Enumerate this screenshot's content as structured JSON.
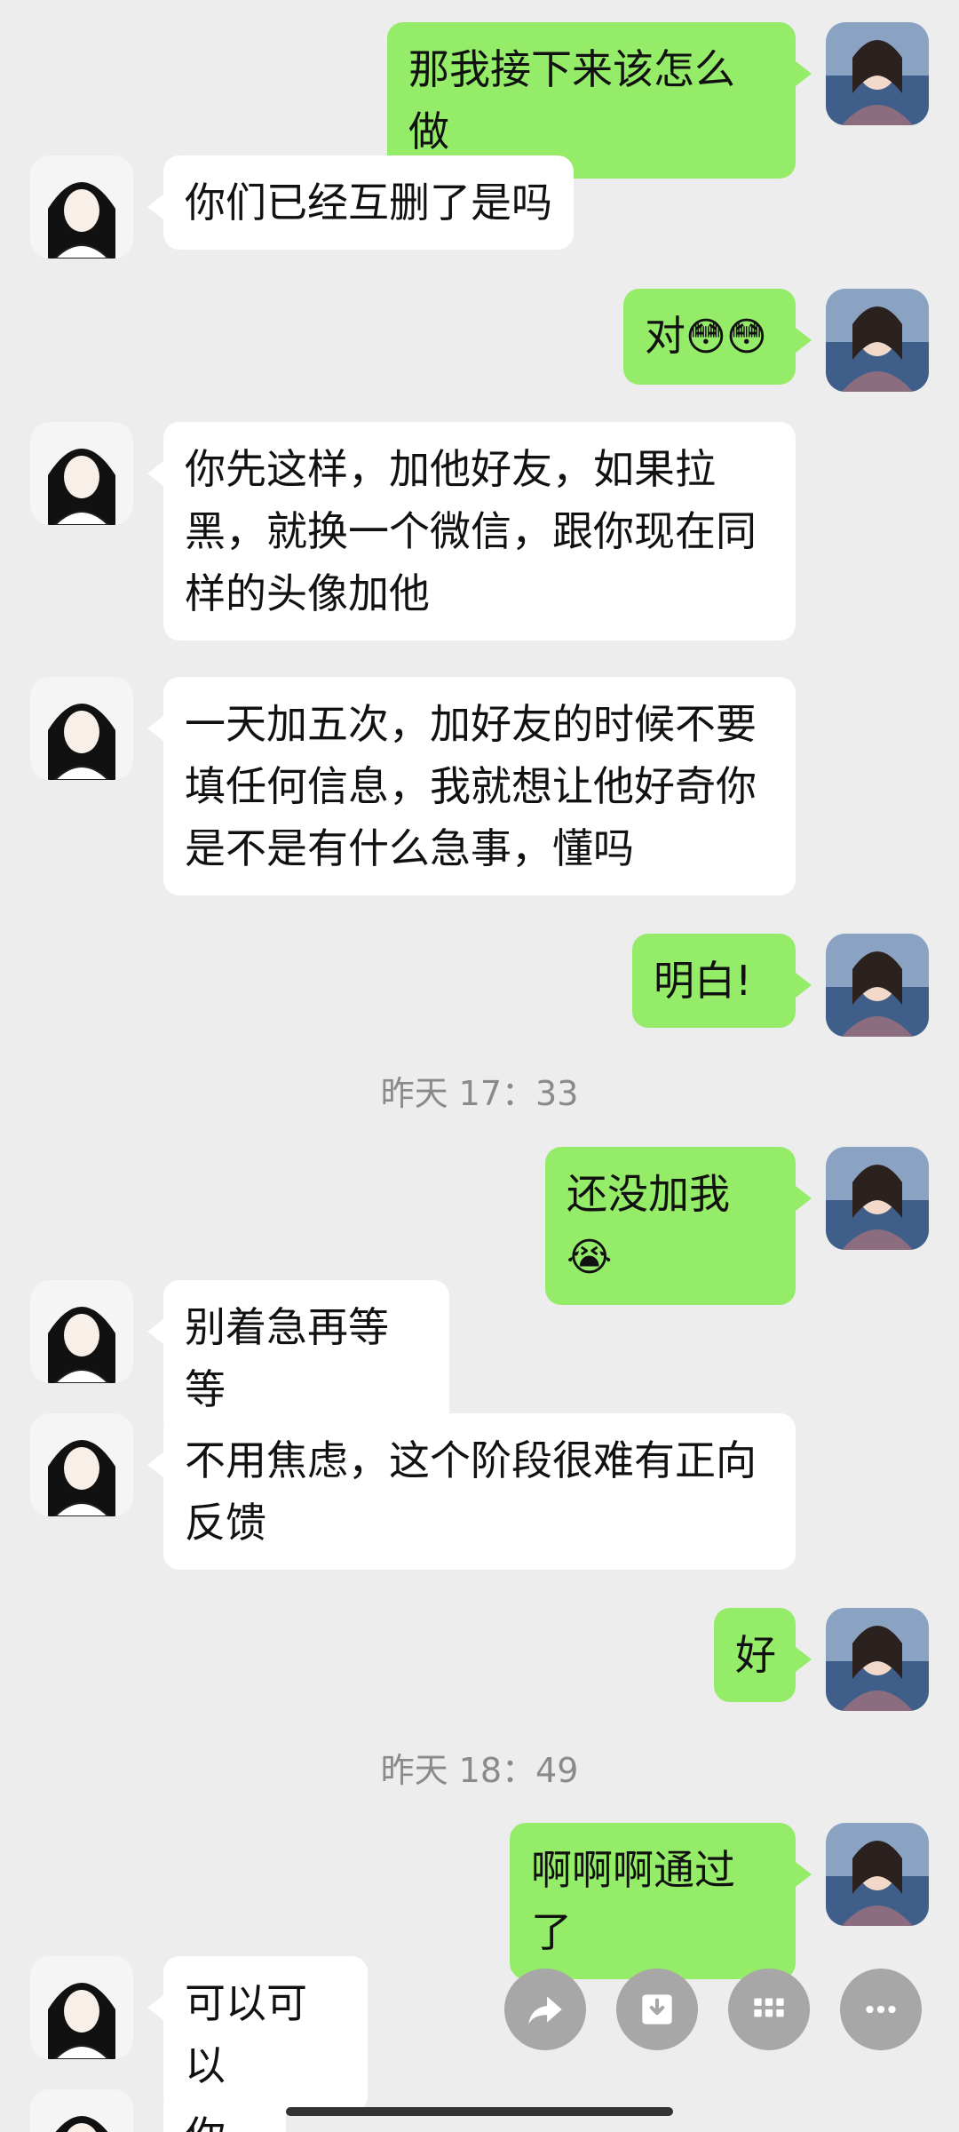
{
  "colors": {
    "background": "#ededed",
    "incoming_bubble": "#ffffff",
    "outgoing_bubble": "#95ec69",
    "timestamp_text": "#8a8a8a",
    "action_button": "#a7a7a7"
  },
  "messages": [
    {
      "side": "right",
      "text": "那我接下来该怎么做"
    },
    {
      "side": "left",
      "text": "你们已经互删了是吗"
    },
    {
      "side": "right",
      "text": "对",
      "emoji": "😳😳"
    },
    {
      "side": "left",
      "text": "你先这样，加他好友，如果拉黑，就换一个微信，跟你现在同样的头像加他"
    },
    {
      "side": "left",
      "text": "一天加五次，加好友的时候不要填任何信息，我就想让他好奇你是不是有什么急事，懂吗"
    },
    {
      "side": "right",
      "text": "明白!"
    },
    {
      "side": "right",
      "text": "还没加我",
      "emoji": "😭"
    },
    {
      "side": "left",
      "text": "别着急再等等"
    },
    {
      "side": "left",
      "text": "不用焦虑，这个阶段很难有正向反馈"
    },
    {
      "side": "right",
      "text": "好"
    },
    {
      "side": "right",
      "text": "啊啊啊通过了"
    },
    {
      "side": "left",
      "text": "可以可以"
    },
    {
      "side": "left",
      "text": "你发"
    }
  ],
  "timestamps": [
    "昨天 17：33",
    "昨天 18：49"
  ],
  "actions": [
    {
      "icon": "forward-icon"
    },
    {
      "icon": "save-icon"
    },
    {
      "icon": "more-apps-icon"
    },
    {
      "icon": "more-icon"
    }
  ]
}
